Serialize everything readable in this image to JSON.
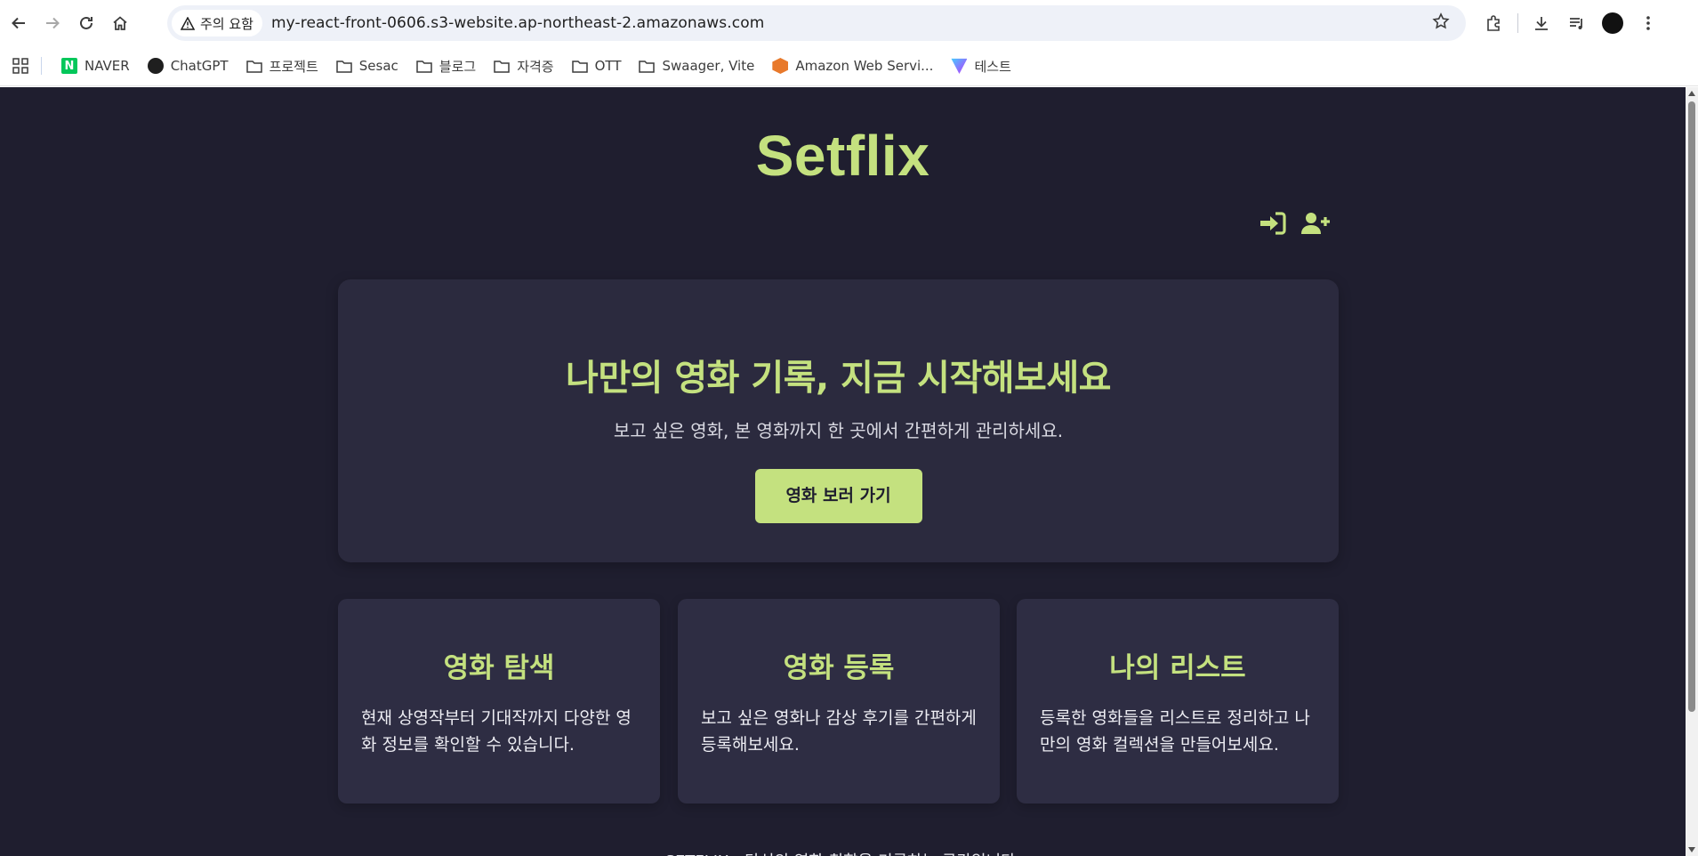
{
  "browser": {
    "security_label": "주의 요함",
    "url": "my-react-front-0606.s3-website.ap-northeast-2.amazonaws.com",
    "bookmarks": [
      {
        "label": "NAVER",
        "icon": "naver-favicon"
      },
      {
        "label": "ChatGPT",
        "icon": "chatgpt-favicon"
      },
      {
        "label": "프로젝트",
        "icon": "folder-icon"
      },
      {
        "label": "Sesac",
        "icon": "folder-icon"
      },
      {
        "label": "블로그",
        "icon": "folder-icon"
      },
      {
        "label": "자격증",
        "icon": "folder-icon"
      },
      {
        "label": "OTT",
        "icon": "folder-icon"
      },
      {
        "label": "Swaager, Vite",
        "icon": "folder-icon"
      },
      {
        "label": "Amazon Web Servi...",
        "icon": "aws-favicon"
      },
      {
        "label": "테스트",
        "icon": "vite-favicon"
      }
    ]
  },
  "site": {
    "title": "Setflix",
    "accent_color": "#c4e17f",
    "background_color": "#1f1e2f"
  },
  "hero": {
    "title": "나만의 영화 기록, 지금 시작해보세요",
    "subtitle": "보고 싶은 영화, 본 영화까지 한 곳에서 간편하게 관리하세요.",
    "button_label": "영화 보러 가기"
  },
  "features": [
    {
      "title": "영화 탐색",
      "desc": "현재 상영작부터 기대작까지 다양한 영화 정보를 확인할 수 있습니다."
    },
    {
      "title": "영화 등록",
      "desc": "보고 싶은 영화나 감상 후기를 간편하게 등록해보세요."
    },
    {
      "title": "나의 리스트",
      "desc": "등록한 영화들을 리스트로 정리하고 나만의 영화 컬렉션을 만들어보세요."
    }
  ],
  "footer": {
    "text": "SETFLIX - 당신의 영화 취향을 기록하는 공간입니다."
  }
}
